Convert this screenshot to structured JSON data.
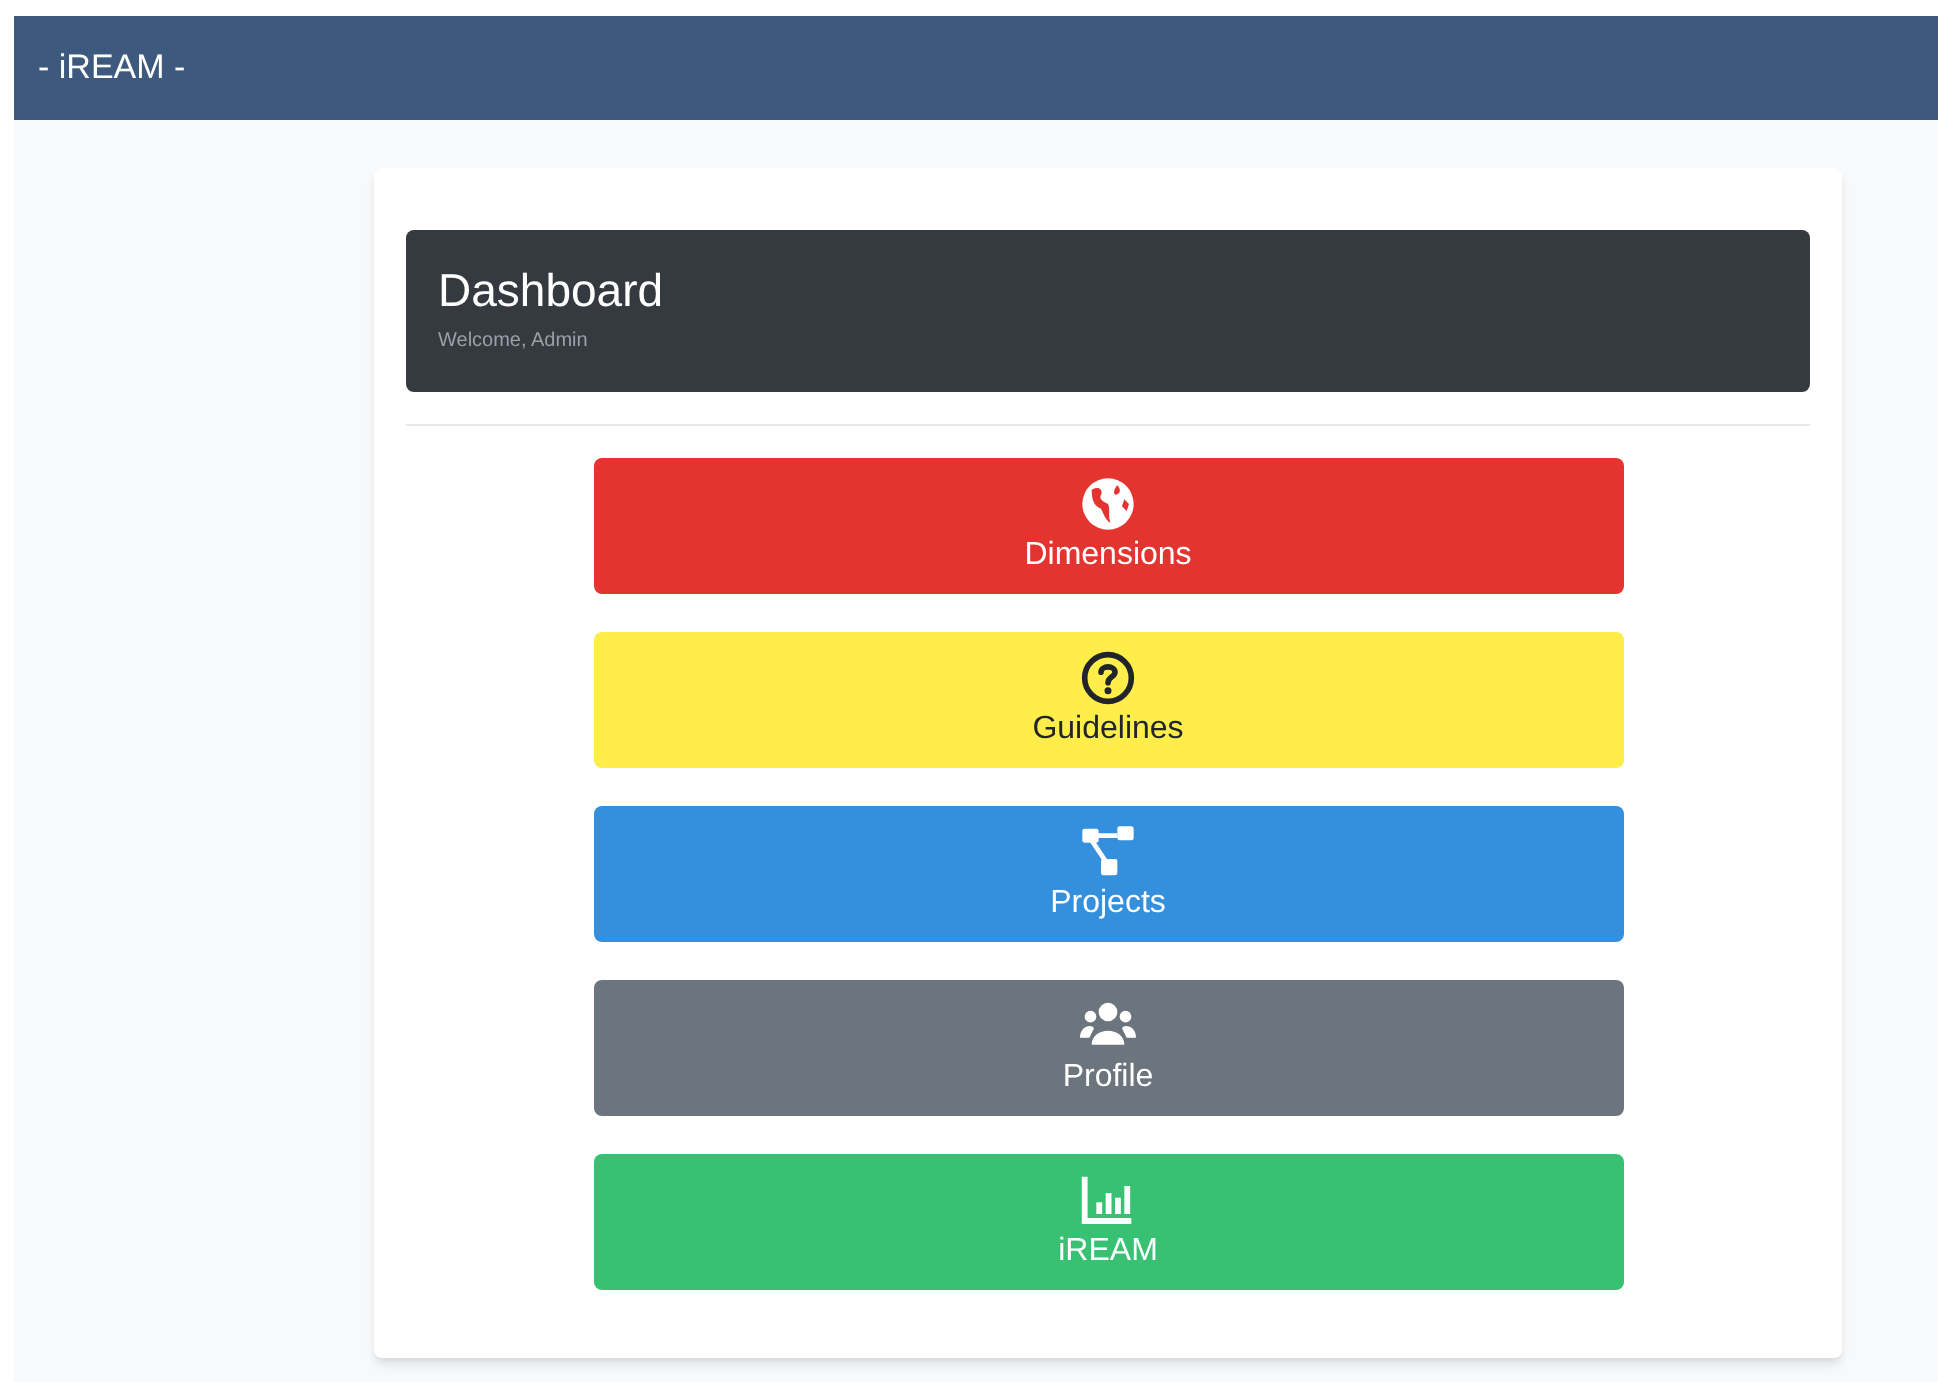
{
  "navbar": {
    "brand": "- iREAM -"
  },
  "header": {
    "title": "Dashboard",
    "subtitle": "Welcome, Admin"
  },
  "buttons": [
    {
      "label": "Dimensions",
      "kind": "globe",
      "color": "#e3342f"
    },
    {
      "label": "Guidelines",
      "kind": "question",
      "color": "#ffed4a"
    },
    {
      "label": "Projects",
      "kind": "sitemap",
      "color": "#3490dc"
    },
    {
      "label": "Profile",
      "kind": "users",
      "color": "#6c757d"
    },
    {
      "label": "iREAM",
      "kind": "chart",
      "color": "#38c172"
    }
  ]
}
